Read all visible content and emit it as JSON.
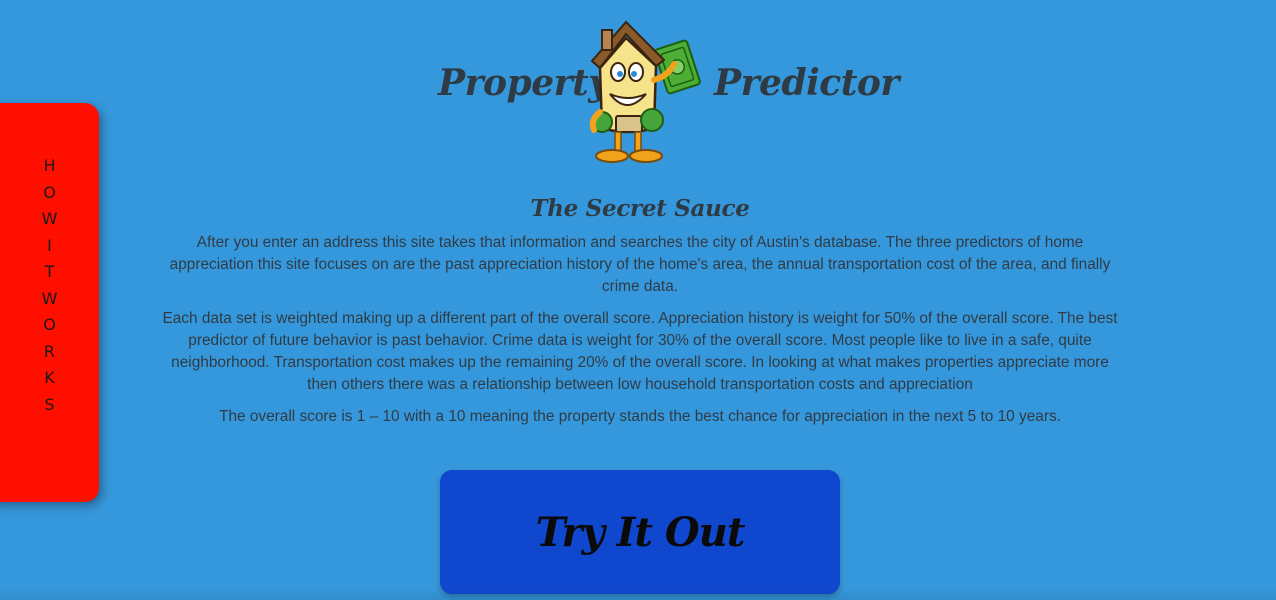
{
  "header": {
    "brand_left": "Property",
    "brand_right": "Predictor",
    "mascot_icon": "house-mascot-icon"
  },
  "side_tab": {
    "letters": [
      "H",
      "O",
      "W",
      "I",
      "T",
      "W",
      "O",
      "R",
      "K",
      "S"
    ],
    "color": "#ff0f00"
  },
  "main": {
    "title": "The Secret Sauce",
    "paragraphs": [
      "After you enter an address this site takes that information and searches the city of Austin's database. The three predictors of home appreciation this site focuses on are the past appreciation history of the home's area, the annual transportation cost of the area, and finally crime data.",
      "Each data set is weighted making up a different part of the overall score. Appreciation history is weight for 50% of the overall score. The best predictor of future behavior is past behavior. Crime data is weight for 30% of the overall score. Most people like to live in a safe, quite neighborhood. Transportation cost makes up the remaining 20% of the overall score. In looking at what makes properties appreciate more then others there was a relationship between low household transportation costs and appreciation",
      "The overall score is 1 – 10 with a 10 meaning the property stands the best chance for appreciation in the next 5 to 10 years."
    ]
  },
  "cta": {
    "label": "Try It Out",
    "color": "#1047cf"
  },
  "colors": {
    "background": "#3698dc",
    "text": "#2f3b45"
  }
}
